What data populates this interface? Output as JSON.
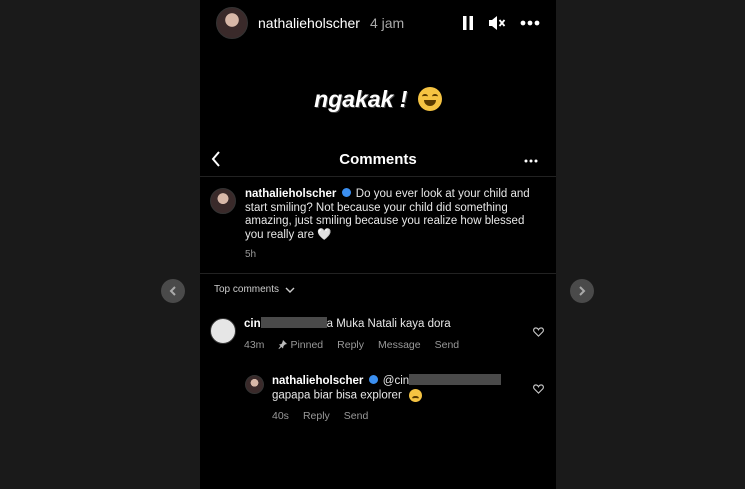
{
  "story": {
    "username": "nathalieholscher",
    "time": "4 jam",
    "sticker_text": "ngakak !"
  },
  "comments_panel": {
    "title": "Comments",
    "caption": {
      "username": "nathalieholscher",
      "text": "Do you ever look at your child and start smiling? Not because your child did something amazing, just smiling because you realize how blessed you really are",
      "heart": "🤍",
      "time": "5h"
    },
    "sort_label": "Top comments",
    "comments": [
      {
        "username_start": "cin",
        "text_end": "a Muka Natali kaya dora",
        "time": "43m",
        "pinned_label": "Pinned",
        "reply_label": "Reply",
        "message_label": "Message",
        "send_label": "Send"
      }
    ],
    "reply": {
      "username": "nathalieholscher",
      "mention_start": "@cin",
      "text": "gapapa biar bisa explorer",
      "time": "40s",
      "reply_label": "Reply",
      "send_label": "Send"
    }
  }
}
